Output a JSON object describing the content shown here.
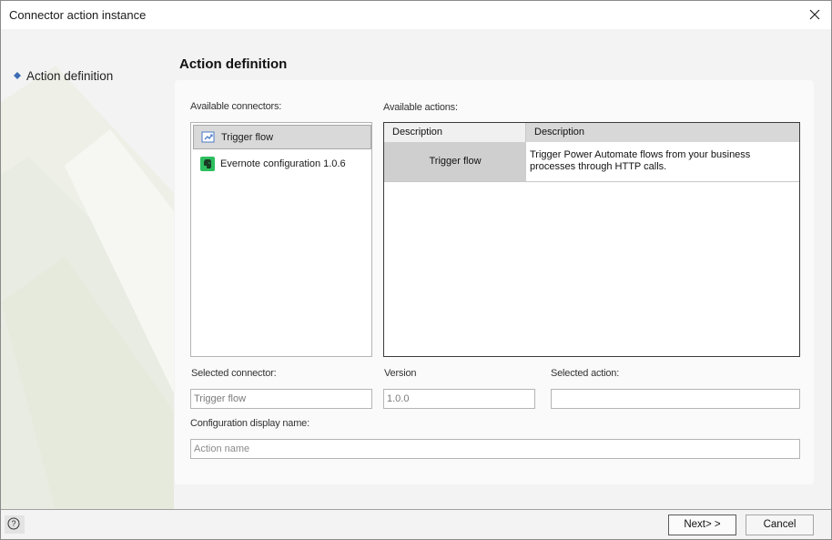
{
  "window": {
    "title": "Connector action instance",
    "close_icon": "close-icon"
  },
  "nav": {
    "items": [
      {
        "label": "Action definition",
        "icon": "diamond-bullet-icon",
        "active": true
      }
    ]
  },
  "page": {
    "title": "Action definition"
  },
  "connectors": {
    "label": "Available connectors:",
    "items": [
      {
        "label": "Trigger flow",
        "icon": "flow-trigger-icon",
        "selected": true
      },
      {
        "label": "Evernote configuration 1.0.6",
        "icon": "evernote-icon",
        "selected": false
      }
    ]
  },
  "actions": {
    "label": "Available actions:",
    "columns": [
      "Description",
      "Description"
    ],
    "rows": [
      {
        "name": "Trigger flow",
        "description": "Trigger Power Automate flows from your business processes through HTTP calls."
      }
    ]
  },
  "form": {
    "selected_connector_label": "Selected connector:",
    "selected_connector_value": "Trigger flow",
    "version_label": "Version",
    "version_value": "1.0.0",
    "selected_action_label": "Selected action:",
    "selected_action_value": "",
    "config_name_label": "Configuration display name:",
    "config_name_placeholder": "Action name"
  },
  "footer": {
    "help_icon": "help-icon",
    "next_label": "Next> >",
    "cancel_label": "Cancel"
  },
  "colors": {
    "accent_bullet": "#3c6db4",
    "selected_row": "#d9d9d9",
    "evernote_green": "#2dbe60"
  }
}
